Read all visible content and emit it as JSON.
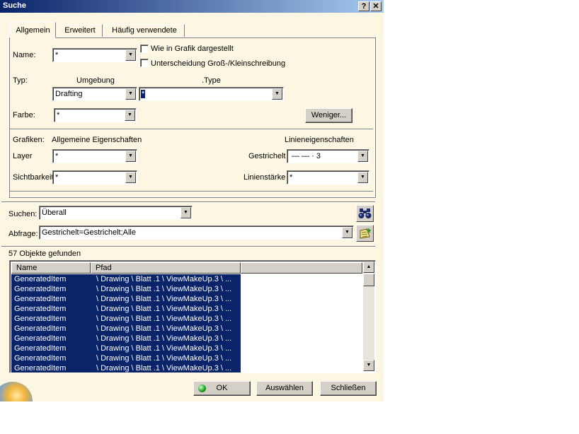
{
  "window": {
    "title": "Suche",
    "help_label": "?",
    "close_label": "✕"
  },
  "tabs": [
    {
      "label": "Allgemein",
      "active": true
    },
    {
      "label": "Erweitert",
      "active": false
    },
    {
      "label": "Häufig verwendete",
      "active": false
    }
  ],
  "general": {
    "name_label": "Name:",
    "name_value": "*",
    "chk_graphic_label": "Wie in Grafik dargestellt",
    "chk_case_label": "Unterscheidung Groß-/Kleinschreibung",
    "type_label": "Typ:",
    "env_header": "Umgebung",
    "type_header": ".Type",
    "env_value": "Drafting",
    "type_value": "*",
    "color_label": "Farbe:",
    "color_value": "*",
    "less_button": "Weniger..."
  },
  "graphics": {
    "graphics_label": "Grafiken:",
    "general_props_header": "Allgemeine Eigenschaften",
    "line_props_header": "Linieneigenschaften",
    "layer_label": "Layer",
    "layer_value": "*",
    "visibility_label": "Sichtbarkeit",
    "visibility_value": "*",
    "dashed_label": "Gestrichelt",
    "dashed_value": "— — · 3",
    "thickness_label": "Linienstärke",
    "thickness_value": "*"
  },
  "search": {
    "search_label": "Suchen:",
    "search_value": "Überall",
    "query_label": "Abfrage:",
    "query_value": "Gestrichelt=Gestrichelt;Alle",
    "search_icon": "binoculars-icon",
    "favorite_icon": "add-favorite-icon"
  },
  "results": {
    "count_text": "57 Objekte gefunden",
    "col_name": "Name",
    "col_path": "Pfad",
    "rows": [
      {
        "name": "GeneratedItem",
        "path": "\\ Drawing \\ Blatt .1 \\ ViewMakeUp.3 \\ ..."
      },
      {
        "name": "GeneratedItem",
        "path": "\\ Drawing \\ Blatt .1 \\ ViewMakeUp.3 \\ ..."
      },
      {
        "name": "GeneratedItem",
        "path": "\\ Drawing \\ Blatt .1 \\ ViewMakeUp.3 \\ ..."
      },
      {
        "name": "GeneratedItem",
        "path": "\\ Drawing \\ Blatt .1 \\ ViewMakeUp.3 \\ ..."
      },
      {
        "name": "GeneratedItem",
        "path": "\\ Drawing \\ Blatt .1 \\ ViewMakeUp.3 \\ ..."
      },
      {
        "name": "GeneratedItem",
        "path": "\\ Drawing \\ Blatt .1 \\ ViewMakeUp.3 \\ ..."
      },
      {
        "name": "GeneratedItem",
        "path": "\\ Drawing \\ Blatt .1 \\ ViewMakeUp.3 \\ ..."
      },
      {
        "name": "GeneratedItem",
        "path": "\\ Drawing \\ Blatt .1 \\ ViewMakeUp.3 \\ ..."
      },
      {
        "name": "GeneratedItem",
        "path": "\\ Drawing \\ Blatt .1 \\ ViewMakeUp.3 \\ ..."
      },
      {
        "name": "GeneratedItem",
        "path": "\\ Drawing \\ Blatt .1 \\ ViewMakeUp.3 \\ ..."
      }
    ]
  },
  "footer": {
    "ok_label": "OK",
    "select_label": "Auswählen",
    "close_label": "Schließen"
  },
  "colors": {
    "title_bar": "#0a246a",
    "selection": "#0a246a",
    "dialog_bg": "#fcf6e2",
    "ok_indicator": "#1e9a1e"
  }
}
